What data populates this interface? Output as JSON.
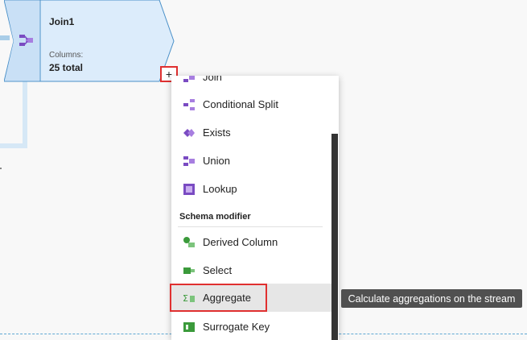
{
  "node": {
    "title": "Join1",
    "columns_label": "Columns:",
    "columns_value": "25 total",
    "add_label": "+"
  },
  "menu": {
    "items_top": [
      {
        "label": "Join",
        "icon": "join-icon"
      },
      {
        "label": "Conditional Split",
        "icon": "conditional-split-icon"
      },
      {
        "label": "Exists",
        "icon": "exists-icon"
      },
      {
        "label": "Union",
        "icon": "union-icon"
      },
      {
        "label": "Lookup",
        "icon": "lookup-icon"
      }
    ],
    "section": "Schema modifier",
    "items_schema": [
      {
        "label": "Derived Column",
        "icon": "derived-column-icon"
      },
      {
        "label": "Select",
        "icon": "select-icon"
      },
      {
        "label": "Aggregate",
        "icon": "aggregate-icon"
      },
      {
        "label": "Surrogate Key",
        "icon": "surrogate-key-icon"
      }
    ]
  },
  "tooltip": "Calculate aggregations on the stream",
  "colors": {
    "node_fill": "#dcecfb",
    "node_border": "#4a90c8",
    "highlight_red": "#e03030",
    "purple": "#7a4bc2",
    "green": "#3b9a3b"
  }
}
